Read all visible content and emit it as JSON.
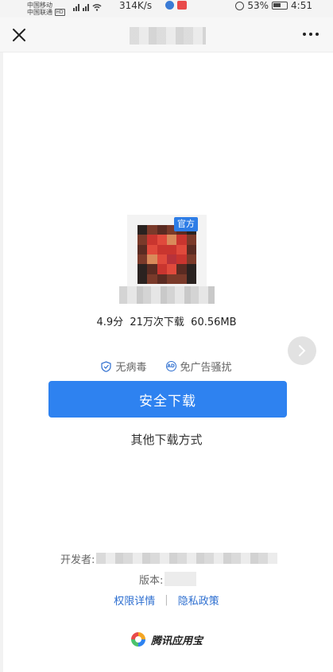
{
  "status_bar": {
    "carrier_1": "中国移动",
    "carrier_2": "中国联通",
    "hd": "HD",
    "network_speed": "314K/s",
    "battery": "53%",
    "time": "4:51"
  },
  "navbar": {
    "close_icon": "close-icon",
    "more_icon": "more-horizontal-icon"
  },
  "app": {
    "official_badge": "官方",
    "stats": "4.9分  21万次下载  60.56MB"
  },
  "badges": {
    "virus_free": "无病毒",
    "no_ads_icon": "AD",
    "no_ads": "免广告骚扰"
  },
  "actions": {
    "safe_download": "安全下载",
    "other_download": "其他下载方式"
  },
  "footer": {
    "developer_label": "开发者:",
    "version_label": "版本:",
    "permissions_link": "权限详情",
    "separator": "|",
    "privacy_link": "隐私政策",
    "brand_name": "腾讯应用宝"
  },
  "colors": {
    "accent": "#2e82f0",
    "link": "#2e6fd0",
    "badge": "#2e7de6"
  }
}
